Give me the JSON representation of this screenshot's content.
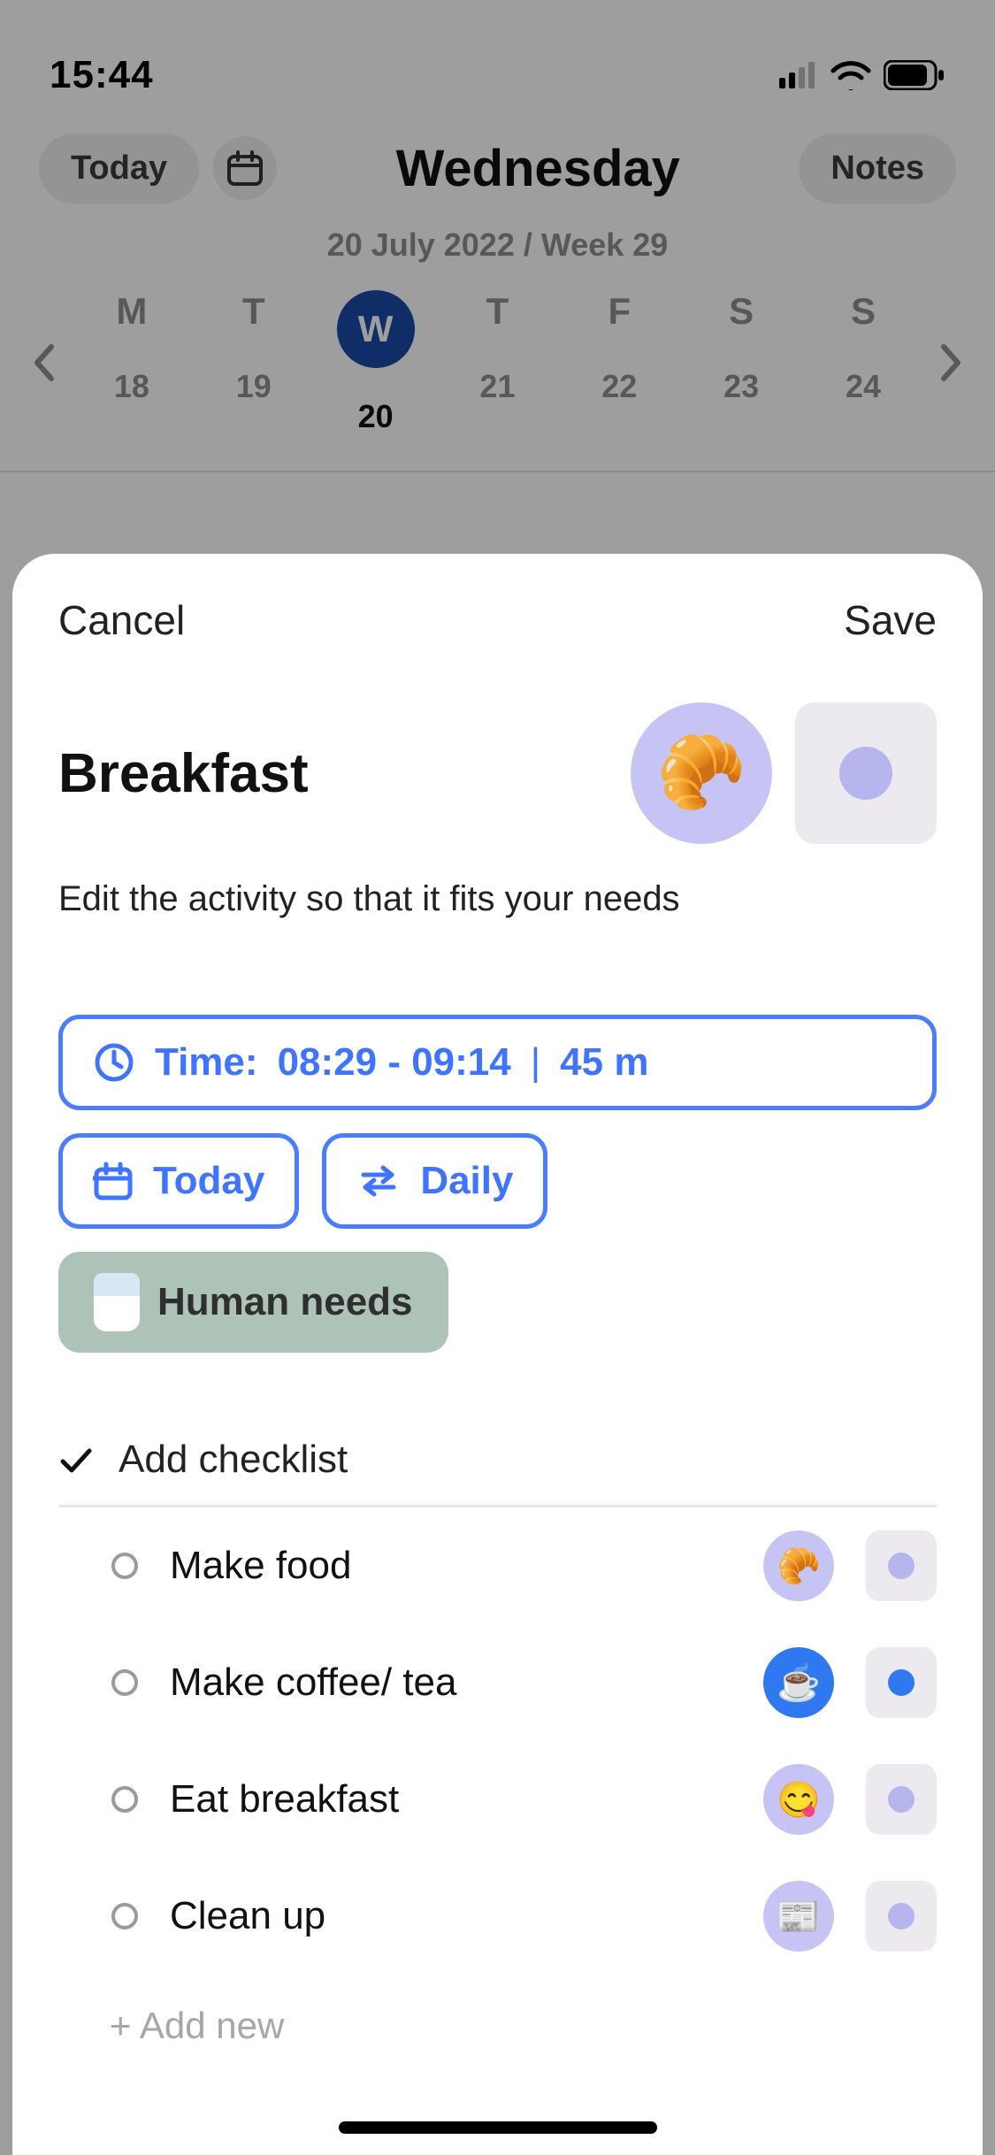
{
  "status": {
    "time": "15:44"
  },
  "nav": {
    "today_label": "Today",
    "notes_label": "Notes",
    "dayname": "Wednesday",
    "subdate": "20 July 2022 / Week 29"
  },
  "weekstrip": {
    "days": [
      {
        "label": "M",
        "num": "18",
        "selected": false
      },
      {
        "label": "T",
        "num": "19",
        "selected": false
      },
      {
        "label": "W",
        "num": "20",
        "selected": true
      },
      {
        "label": "T",
        "num": "21",
        "selected": false
      },
      {
        "label": "F",
        "num": "22",
        "selected": false
      },
      {
        "label": "S",
        "num": "23",
        "selected": false
      },
      {
        "label": "S",
        "num": "24",
        "selected": false
      }
    ]
  },
  "sheet": {
    "cancel": "Cancel",
    "save": "Save",
    "title": "Breakfast",
    "title_emoji": "🥐",
    "subtitle": "Edit the activity so that it fits your needs",
    "time_chip_prefix": "Time:",
    "time_range": "08:29 - 09:14",
    "time_sep": "|",
    "duration": "45 m",
    "date_chip": "Today",
    "repeat_chip": "Daily",
    "category_chip": "Human needs",
    "checklist_header": "Add checklist",
    "items": [
      {
        "label": "Make food",
        "emoji": "🥐",
        "circ_bg": "lilac",
        "dot": "lilac"
      },
      {
        "label": "Make coffee/ tea",
        "emoji": "☕",
        "circ_bg": "blue",
        "dot": "blue"
      },
      {
        "label": "Eat breakfast",
        "emoji": "😋",
        "circ_bg": "lilac",
        "dot": "lilac"
      },
      {
        "label": "Clean up",
        "emoji": "📰",
        "circ_bg": "lilac",
        "dot": "lilac"
      }
    ],
    "add_new": "+ Add new"
  }
}
